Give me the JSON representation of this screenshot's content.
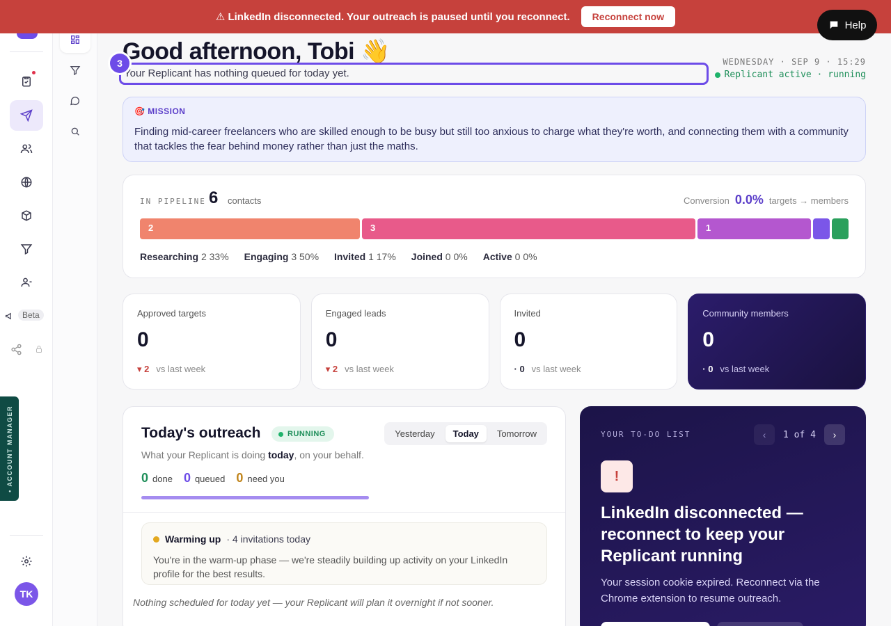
{
  "banner": {
    "text": "⚠ LinkedIn disconnected. Your outreach is paused until you reconnect.",
    "button": "Reconnect now"
  },
  "help": {
    "label": "Help"
  },
  "rail": {
    "beta_label": "Beta",
    "avatar_initials": "TK",
    "account_manager_label": "• ACCOUNT MANAGER"
  },
  "header": {
    "greeting": "Good afternoon, Tobi 👋",
    "subtitle": "Your Replicant has nothing queued for today yet.",
    "step_badge": "3",
    "date": "WEDNESDAY · SEP 9 · 15:29",
    "status": "Replicant active · running"
  },
  "mission": {
    "label": "🎯 MISSION",
    "text": "Finding mid-career freelancers who are skilled enough to be busy but still too anxious to charge what they're worth, and connecting them with a community that tackles the fear behind money rather than just the maths."
  },
  "pipeline": {
    "label": "IN PIPELINE",
    "count": "6",
    "unit": "contacts",
    "conversion_label": "Conversion",
    "conversion_value": "0.0%",
    "conversion_suffix": "targets → members",
    "segments": [
      {
        "label": "2",
        "share": 0.33,
        "color": "#f0846d"
      },
      {
        "label": "3",
        "share": 0.5,
        "color": "#e85a8a"
      },
      {
        "label": "1",
        "share": 0.17,
        "color": "#b457cf"
      },
      {
        "label": "",
        "share": 0,
        "color": "#7b56e8"
      },
      {
        "label": "",
        "share": 0,
        "color": "#2aa05c"
      }
    ],
    "stages": [
      {
        "name": "Researching",
        "count": "2",
        "pct": "33%"
      },
      {
        "name": "Engaging",
        "count": "3",
        "pct": "50%"
      },
      {
        "name": "Invited",
        "count": "1",
        "pct": "17%"
      },
      {
        "name": "Joined",
        "count": "0",
        "pct": "0%"
      },
      {
        "name": "Active",
        "count": "0",
        "pct": "0%"
      }
    ]
  },
  "cards": [
    {
      "label": "Approved targets",
      "value": "0",
      "delta": "▾ 2",
      "delta_suffix": "vs last week"
    },
    {
      "label": "Engaged leads",
      "value": "0",
      "delta": "▾ 2",
      "delta_suffix": "vs last week"
    },
    {
      "label": "Invited",
      "value": "0",
      "delta": "· 0",
      "delta_suffix": "vs last week"
    },
    {
      "label": "Community members",
      "value": "0",
      "delta": "· 0",
      "delta_suffix": "vs last week"
    }
  ],
  "outreach": {
    "title": "Today's outreach",
    "badge": "RUNNING",
    "tabs": [
      "Yesterday",
      "Today",
      "Tomorrow"
    ],
    "active_tab": "Today",
    "subtitle_pre": "What your Replicant is doing",
    "subtitle_bold": "today",
    "subtitle_post": ", on your behalf.",
    "stats": [
      {
        "value": "0",
        "label": "done"
      },
      {
        "value": "0",
        "label": "queued"
      },
      {
        "value": "0",
        "label": "need you"
      }
    ],
    "warm_title": "Warming up",
    "warm_detail": "· 4 invitations today",
    "warm_text": "You're in the warm-up phase — we're steadily building up activity on your LinkedIn profile for the best results.",
    "nothing": "Nothing scheduled for today yet — your Replicant will plan it overnight if not sooner."
  },
  "todo": {
    "label": "YOUR TO-DO LIST",
    "counter": "1 of 4",
    "alert_glyph": "!",
    "title": "LinkedIn disconnected — reconnect to keep your Replicant running",
    "text": "Your session cookie expired. Reconnect via the Chrome extension to resume outreach."
  }
}
